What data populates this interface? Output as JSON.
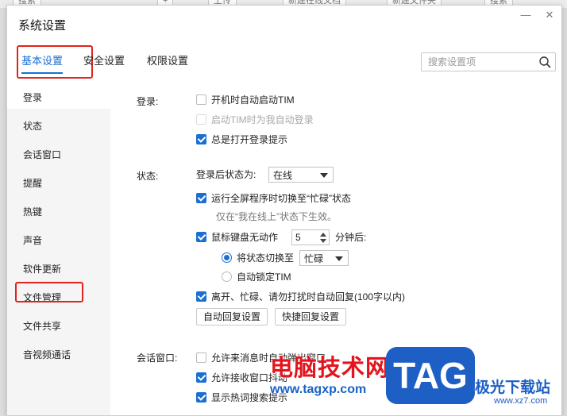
{
  "background_toolbar": {
    "search": "搜索",
    "plus": "+",
    "upload": "上传",
    "new_doc": "新建在线文档",
    "new_folder": "新建文件夹",
    "search2": "搜索"
  },
  "dialog": {
    "title": "系统设置",
    "minimize": "—",
    "close": "✕"
  },
  "tabs": [
    {
      "label": "基本设置",
      "active": true
    },
    {
      "label": "安全设置",
      "active": false
    },
    {
      "label": "权限设置",
      "active": false
    }
  ],
  "search": {
    "placeholder": "搜索设置项"
  },
  "sidebar": {
    "items": [
      {
        "label": "登录",
        "selected": true
      },
      {
        "label": "状态"
      },
      {
        "label": "会话窗口"
      },
      {
        "label": "提醒"
      },
      {
        "label": "热键"
      },
      {
        "label": "声音"
      },
      {
        "label": "软件更新"
      },
      {
        "label": "文件管理"
      },
      {
        "label": "文件共享"
      },
      {
        "label": "音视频通话"
      }
    ]
  },
  "login": {
    "label": "登录:",
    "auto_start": {
      "label": "开机时自动启动TIM",
      "checked": false
    },
    "auto_login": {
      "label": "启动TIM时为我自动登录",
      "checked": false,
      "disabled": true
    },
    "show_prompt": {
      "label": "总是打开登录提示",
      "checked": true
    }
  },
  "status": {
    "label": "状态:",
    "after_login_label": "登录后状态为:",
    "after_login_value": "在线",
    "fullscreen_busy": {
      "label": "运行全屏程序时切换至“忙碌”状态",
      "checked": true
    },
    "fullscreen_hint": "仅在“我在线上”状态下生效。",
    "idle": {
      "label": "鼠标键盘无动作",
      "checked": true,
      "minutes": "5",
      "suffix": "分钟后:"
    },
    "switch_to": {
      "label": "将状态切换至",
      "selected": true,
      "value": "忙碌"
    },
    "auto_lock": {
      "label": "自动锁定TIM",
      "selected": false
    },
    "auto_reply": {
      "label": "离开、忙碌、请勿打扰时自动回复(100字以内)",
      "checked": true
    },
    "auto_reply_btn": "自动回复设置",
    "quick_reply_btn": "快捷回复设置"
  },
  "session": {
    "label": "会话窗口:",
    "allow_popup": {
      "label": "允许来消息时自动弹出窗口",
      "checked": false
    },
    "allow_shake": {
      "label": "允许接收窗口抖动",
      "checked": true
    },
    "show_hot": {
      "label": "显示热词搜索提示",
      "checked": true
    }
  },
  "watermark": {
    "cn": "电脑技术网",
    "url": "www.tagxp.com",
    "tag": "TAG",
    "site": "极光下载站",
    "site_url": "www.xz7.com"
  },
  "colors": {
    "accent": "#1a6fd1",
    "highlight": "#e0231d"
  }
}
